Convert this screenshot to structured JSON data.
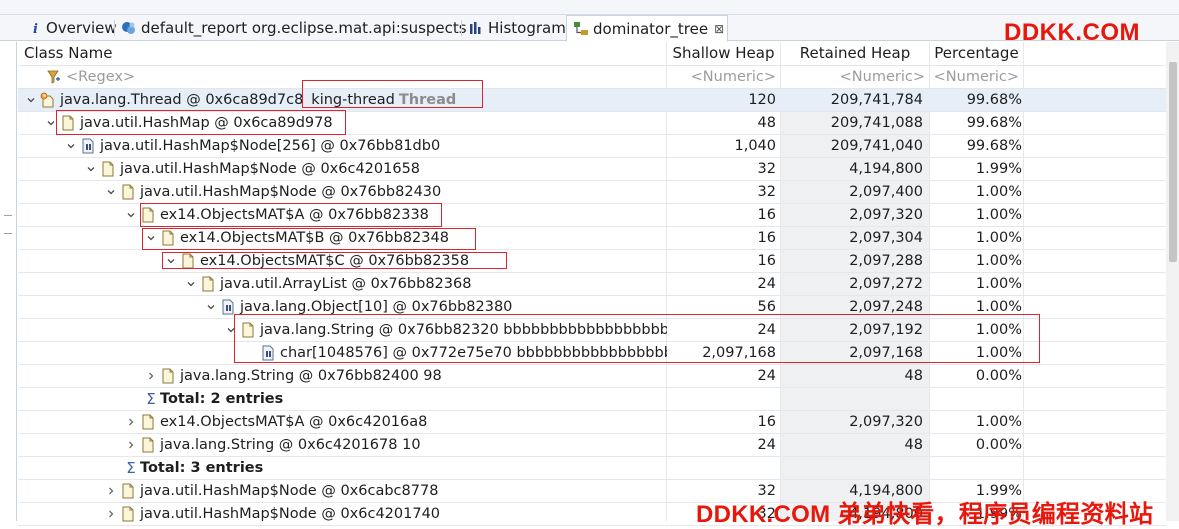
{
  "tabs": [
    {
      "label": "Overview",
      "icon": "info-icon"
    },
    {
      "label": "default_report  org.eclipse.mat.api:suspects",
      "icon": "report-icon"
    },
    {
      "label": "Histogram",
      "icon": "histogram-icon"
    },
    {
      "label": "dominator_tree",
      "icon": "dominator-tree-icon",
      "close": "⊠"
    }
  ],
  "watermark": {
    "top": "DDKK.COM",
    "bottom": "DDKK.COM 弟弟快看，程序员编程资料站"
  },
  "columns": {
    "class_name": "Class Name",
    "shallow_heap": "Shallow Heap",
    "retained_heap": "Retained Heap",
    "percentage": "Percentage"
  },
  "filters": {
    "class_name": "<Regex>",
    "shallow_heap": "<Numeric>",
    "retained_heap": "<Numeric>",
    "percentage": "<Numeric>"
  },
  "colors": {
    "highlight": "#e0242e",
    "watermark": "#e8170b",
    "selection": "#e6eef8"
  },
  "rows": [
    {
      "depth": 0,
      "chev": "down",
      "icon": "thread-icon",
      "label": "java.lang.Thread @ 0x6ca89d7c8",
      "extra": "king-thread",
      "extra_bold": "Thread",
      "shallow": "120",
      "retained": "209,741,784",
      "pct": "99.68%",
      "selected": true
    },
    {
      "depth": 1,
      "chev": "down",
      "icon": "object-icon",
      "label": "java.util.HashMap @ 0x6ca89d978",
      "shallow": "48",
      "retained": "209,741,088",
      "pct": "99.68%"
    },
    {
      "depth": 2,
      "chev": "down",
      "icon": "array-icon",
      "label": "java.util.HashMap$Node[256] @ 0x76bb81db0",
      "shallow": "1,040",
      "retained": "209,741,040",
      "pct": "99.68%"
    },
    {
      "depth": 3,
      "chev": "down",
      "icon": "object-icon",
      "label": "java.util.HashMap$Node @ 0x6c4201658",
      "shallow": "32",
      "retained": "4,194,800",
      "pct": "1.99%"
    },
    {
      "depth": 4,
      "chev": "down",
      "icon": "object-icon",
      "label": "java.util.HashMap$Node @ 0x76bb82430",
      "shallow": "32",
      "retained": "2,097,400",
      "pct": "1.00%"
    },
    {
      "depth": 5,
      "chev": "down",
      "icon": "object-icon",
      "label": "ex14.ObjectsMAT$A @ 0x76bb82338",
      "shallow": "16",
      "retained": "2,097,320",
      "pct": "1.00%"
    },
    {
      "depth": 6,
      "chev": "down",
      "icon": "object-icon",
      "label": "ex14.ObjectsMAT$B @ 0x76bb82348",
      "shallow": "16",
      "retained": "2,097,304",
      "pct": "1.00%"
    },
    {
      "depth": 7,
      "chev": "down",
      "icon": "object-icon",
      "label": "ex14.ObjectsMAT$C @ 0x76bb82358",
      "shallow": "16",
      "retained": "2,097,288",
      "pct": "1.00%"
    },
    {
      "depth": 8,
      "chev": "down",
      "icon": "object-icon",
      "label": "java.util.ArrayList @ 0x76bb82368",
      "shallow": "24",
      "retained": "2,097,272",
      "pct": "1.00%"
    },
    {
      "depth": 9,
      "chev": "down",
      "icon": "array-icon",
      "label": "java.lang.Object[10] @ 0x76bb82380",
      "shallow": "56",
      "retained": "2,097,248",
      "pct": "1.00%"
    },
    {
      "depth": 10,
      "chev": "down",
      "icon": "object-icon",
      "label": "java.lang.String @ 0x76bb82320  bbbbbbbbbbbbbbbbbbbbbbb",
      "shallow": "24",
      "retained": "2,097,192",
      "pct": "1.00%"
    },
    {
      "depth": 11,
      "chev": "none",
      "icon": "array-icon",
      "label": "char[1048576] @ 0x772e75e70  bbbbbbbbbbbbbbbbbbbbbbb",
      "shallow": "2,097,168",
      "retained": "2,097,168",
      "pct": "1.00%"
    },
    {
      "depth": 6,
      "chev": "right",
      "icon": "object-icon",
      "label": "java.lang.String @ 0x76bb82400  98",
      "shallow": "24",
      "retained": "48",
      "pct": "0.00%"
    },
    {
      "depth": 6,
      "chev": "sum",
      "icon": "none",
      "label": "Total: 2 entries",
      "bold": true,
      "shallow": "",
      "retained": "",
      "pct": ""
    },
    {
      "depth": 5,
      "chev": "right",
      "icon": "object-icon",
      "label": "ex14.ObjectsMAT$A @ 0x6c42016a8",
      "shallow": "16",
      "retained": "2,097,320",
      "pct": "1.00%"
    },
    {
      "depth": 5,
      "chev": "right",
      "icon": "object-icon",
      "label": "java.lang.String @ 0x6c4201678  10",
      "shallow": "24",
      "retained": "48",
      "pct": "0.00%"
    },
    {
      "depth": 5,
      "chev": "sum",
      "icon": "none",
      "label": "Total: 3 entries",
      "bold": true,
      "shallow": "",
      "retained": "",
      "pct": ""
    },
    {
      "depth": 4,
      "chev": "right",
      "icon": "object-icon",
      "label": "java.util.HashMap$Node @ 0x6cabc8778",
      "shallow": "32",
      "retained": "4,194,800",
      "pct": "1.99%"
    },
    {
      "depth": 4,
      "chev": "right",
      "icon": "object-icon",
      "label": "java.util.HashMap$Node @ 0x6c4201740",
      "shallow": "32",
      "retained": "4,194,800",
      "pct": "1.99%"
    }
  ]
}
